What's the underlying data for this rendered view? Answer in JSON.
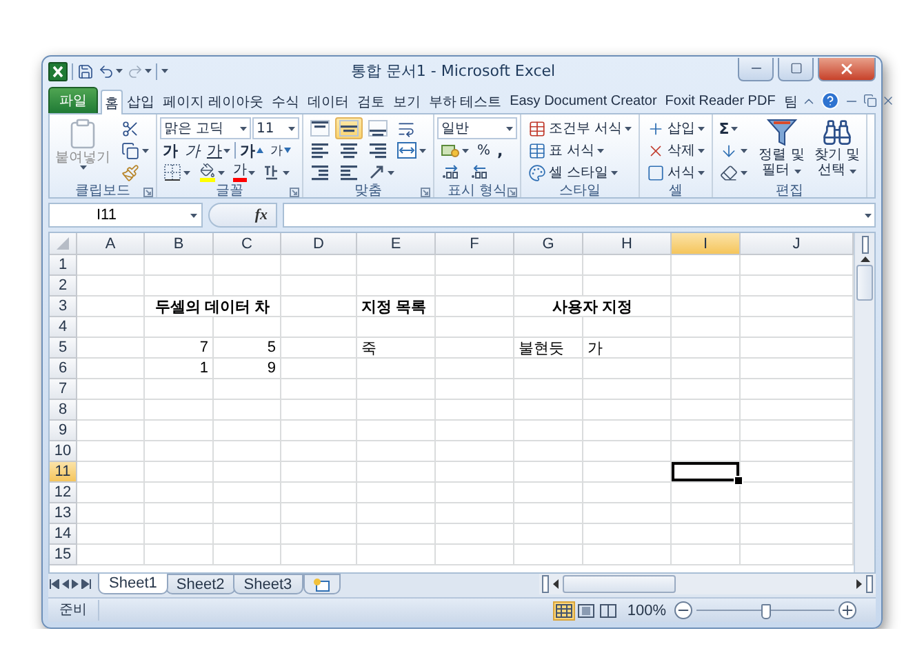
{
  "window": {
    "title": "통합 문서1 - Microsoft Excel"
  },
  "ribbon_tabs": [
    {
      "label": "파일",
      "kind": "file",
      "selected": false
    },
    {
      "label": "홈",
      "kind": "tab",
      "selected": true
    },
    {
      "label": "삽입",
      "kind": "tab",
      "selected": false
    },
    {
      "label": "페이지 레이아웃",
      "kind": "tab",
      "selected": false
    },
    {
      "label": "수식",
      "kind": "tab",
      "selected": false
    },
    {
      "label": "데이터",
      "kind": "tab",
      "selected": false
    },
    {
      "label": "검토",
      "kind": "tab",
      "selected": false
    },
    {
      "label": "보기",
      "kind": "tab",
      "selected": false
    },
    {
      "label": "부하 테스트",
      "kind": "tab",
      "selected": false
    },
    {
      "label": "Easy Document Creator",
      "kind": "tab",
      "selected": false
    },
    {
      "label": "Foxit Reader PDF",
      "kind": "tab",
      "selected": false
    },
    {
      "label": "팀",
      "kind": "tab",
      "selected": false
    }
  ],
  "ribbon": {
    "clipboard": {
      "label": "클립보드",
      "paste": {
        "label": "붙여넣기",
        "disabled": true
      }
    },
    "font": {
      "label": "글꼴",
      "name": "맑은 고딕",
      "size": "11",
      "bold": "가",
      "italic": "가",
      "underline": "가",
      "grow": "가",
      "shrink": "가",
      "font_color_button": "가"
    },
    "alignment": {
      "label": "맞춤",
      "vertical": [
        {
          "selected": false
        },
        {
          "selected": true
        },
        {
          "selected": false
        }
      ]
    },
    "number": {
      "label": "표시 형식",
      "format": "일반",
      "percent": "%",
      "comma": ","
    },
    "styles": {
      "label": "스타일",
      "items": [
        "조건부 서식",
        "표 서식",
        "셀 스타일"
      ]
    },
    "cells": {
      "label": "셀",
      "items": [
        "삽입",
        "삭제",
        "서식"
      ]
    },
    "editing": {
      "label": "편집",
      "sum": "Σ",
      "sort": [
        "정렬 및",
        "필터"
      ],
      "find": [
        "찾기 및",
        "선택"
      ]
    }
  },
  "formula_bar": {
    "name_box": "I11",
    "function_label": "fx"
  },
  "sheet": {
    "columns": [
      {
        "label": "A",
        "selected": false
      },
      {
        "label": "B",
        "selected": false
      },
      {
        "label": "C",
        "selected": false
      },
      {
        "label": "D",
        "selected": false
      },
      {
        "label": "E",
        "selected": false
      },
      {
        "label": "F",
        "selected": false
      },
      {
        "label": "G",
        "selected": false
      },
      {
        "label": "H",
        "selected": false
      },
      {
        "label": "I",
        "selected": true
      },
      {
        "label": "J",
        "selected": false
      }
    ],
    "rows": [
      {
        "label": "1",
        "selected": false
      },
      {
        "label": "2",
        "selected": false
      },
      {
        "label": "3",
        "selected": false,
        "cells": {
          "B": {
            "text": "두셀의 데이터 차",
            "kind": "title",
            "merge_across": true
          },
          "E": {
            "text": "지정 목록",
            "kind": "heading"
          },
          "G": {
            "text": "사용자 지정",
            "kind": "title",
            "merge_across": true
          }
        }
      },
      {
        "label": "4",
        "selected": false
      },
      {
        "label": "5",
        "selected": false,
        "cells": {
          "B": {
            "text": "7",
            "kind": "number"
          },
          "C": {
            "text": "5",
            "kind": "number"
          },
          "E": {
            "text": "죽",
            "kind": "text"
          },
          "G": {
            "text": "불현듯",
            "kind": "text"
          },
          "H": {
            "text": "가",
            "kind": "text"
          }
        }
      },
      {
        "label": "6",
        "selected": false,
        "cells": {
          "B": {
            "text": "1",
            "kind": "number"
          },
          "C": {
            "text": "9",
            "kind": "number"
          }
        }
      },
      {
        "label": "7",
        "selected": false
      },
      {
        "label": "8",
        "selected": false
      },
      {
        "label": "9",
        "selected": false
      },
      {
        "label": "10",
        "selected": false
      },
      {
        "label": "11",
        "selected": true
      },
      {
        "label": "12",
        "selected": false
      },
      {
        "label": "13",
        "selected": false
      },
      {
        "label": "14",
        "selected": false
      },
      {
        "label": "15",
        "selected": false
      }
    ]
  },
  "sheet_tabs": [
    {
      "label": "Sheet1",
      "selected": true
    },
    {
      "label": "Sheet2",
      "selected": false
    },
    {
      "label": "Sheet3",
      "selected": false
    }
  ],
  "status_bar": {
    "text": "준비",
    "views": [
      {
        "kind": "normal",
        "selected": true
      },
      {
        "kind": "page-layout",
        "selected": false
      },
      {
        "kind": "page-break",
        "selected": false
      }
    ],
    "zoom": {
      "label": "100%",
      "level": 0.5
    }
  }
}
